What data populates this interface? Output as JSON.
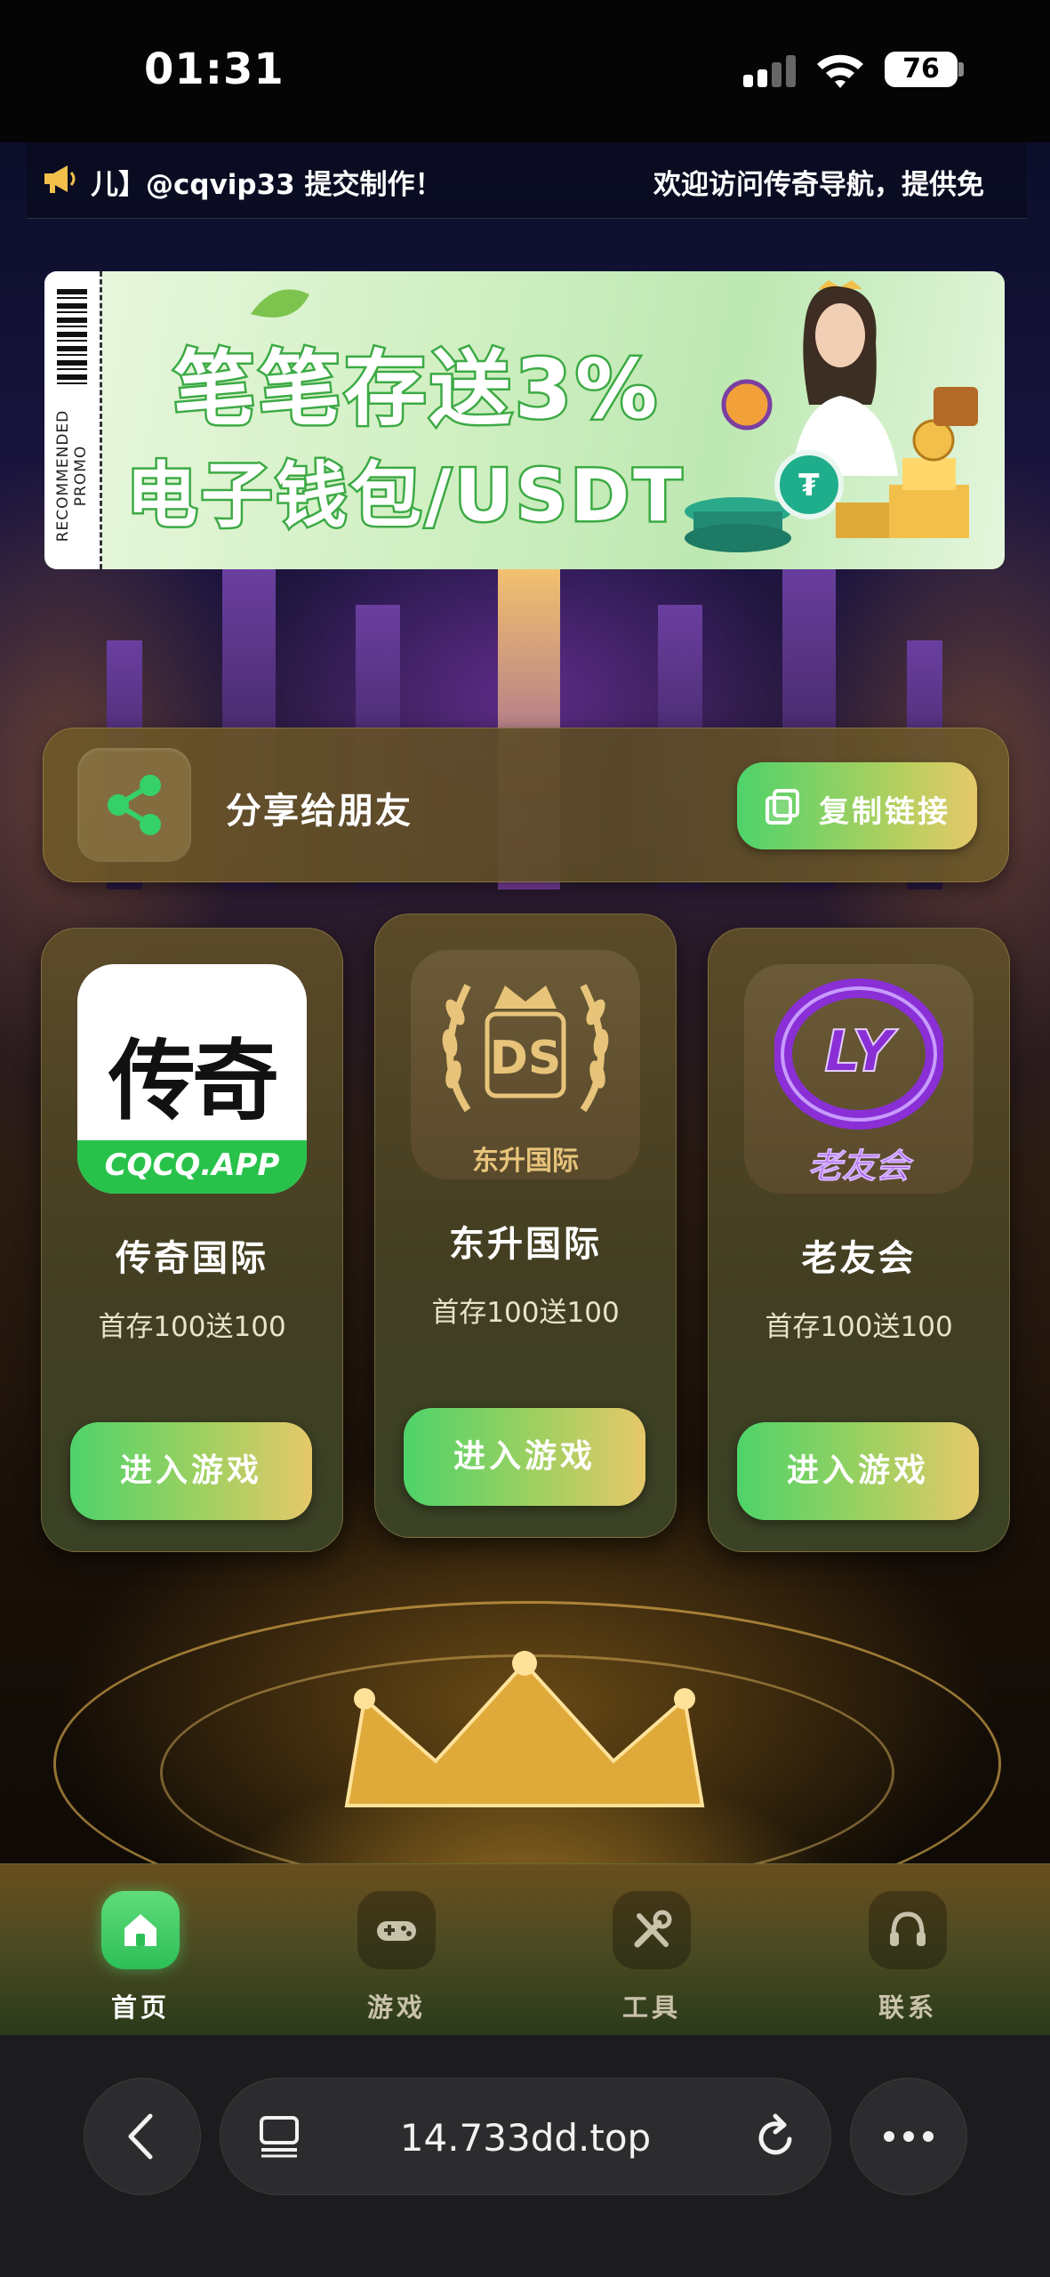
{
  "status_bar": {
    "time": "01:31",
    "battery": "76"
  },
  "marquee": {
    "left_text": "儿】@cqvip33 提交制作！",
    "right_text": "欢迎访问传奇导航，提供免"
  },
  "promo": {
    "line1": "笔笔存送3%",
    "line2": "电子钱包/USDT",
    "stub_label": "RECOMMENDED PROMO"
  },
  "share": {
    "label": "分享给朋友",
    "copy_label": "复制链接"
  },
  "cards": [
    {
      "name": "传奇国际",
      "promo": "首存100送100",
      "button": "进入游戏",
      "logo_text": "传奇",
      "logo_sub": "CQCQ.APP"
    },
    {
      "name": "东升国际",
      "promo": "首存100送100",
      "button": "进入游戏",
      "logo_text": "DS",
      "logo_sub": "东升国际"
    },
    {
      "name": "老友会",
      "promo": "首存100送100",
      "button": "进入游戏",
      "logo_text": "LY",
      "logo_sub": "老友会"
    }
  ],
  "nav": [
    {
      "label": "首页",
      "icon": "home-icon",
      "active": true
    },
    {
      "label": "游戏",
      "icon": "gamepad-icon",
      "active": false
    },
    {
      "label": "工具",
      "icon": "tools-icon",
      "active": false
    },
    {
      "label": "联系",
      "icon": "headset-icon",
      "active": false
    }
  ],
  "browser": {
    "url": "14.733dd.top"
  },
  "colors": {
    "accent_green": "#4ed36a",
    "accent_gold": "#e6c86a",
    "card_bg": "#5f4e28"
  }
}
